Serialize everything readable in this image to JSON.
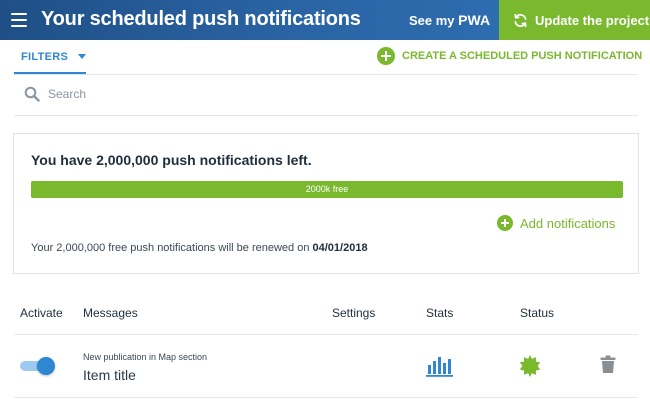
{
  "header": {
    "title": "Your scheduled push notifications",
    "see_pwa_prefix": "See my",
    "see_pwa_strong": "PWA",
    "update_label": "Update the project",
    "menu_icon": "hamburger-menu-icon",
    "update_icon": "refresh-icon"
  },
  "toolbar": {
    "filters_label": "FILTERS",
    "create_label": "CREATE A SCHEDULED PUSH NOTIFICATION"
  },
  "search": {
    "placeholder": "Search",
    "icon": "search-icon"
  },
  "quota": {
    "title": "You have 2,000,000 push notifications left.",
    "progress_label": "2000k free",
    "progress_fraction": 1.0,
    "add_label": "Add notifications",
    "renew_text": "Your 2,000,000 free push notifications will be renewed on",
    "renew_date": "04/01/2018"
  },
  "table": {
    "columns": [
      "Activate",
      "Messages",
      "Settings",
      "Stats",
      "Status"
    ],
    "rows": [
      {
        "active": true,
        "subtitle": "New publication in Map section",
        "title": "Item title",
        "stats_icon": "bar-chart-icon",
        "status_icon": "status-badge-icon",
        "delete_icon": "trash-icon"
      }
    ]
  },
  "colors": {
    "header_start": "#1f4f86",
    "header_end": "#2f72b7",
    "accent_green": "#7ab82e",
    "accent_blue": "#2f86d2"
  }
}
